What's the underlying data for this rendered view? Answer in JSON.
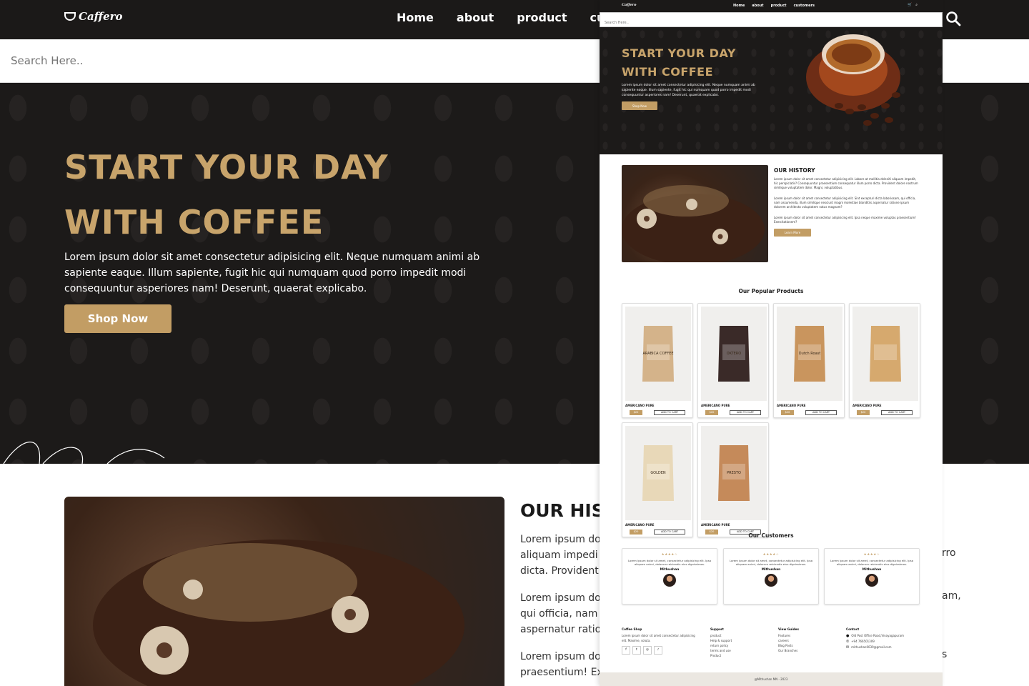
{
  "brand": {
    "logo": "Caffero"
  },
  "nav": {
    "links": [
      "Home",
      "about",
      "product",
      "customers"
    ]
  },
  "search": {
    "placeholder": "Search Here.."
  },
  "mobile_search": {
    "placeholder": "Search Here.."
  },
  "hero": {
    "line1": "START YOUR DAY",
    "line2": "WITH COFFEE",
    "text": "Lorem ipsum dolor sit amet consectetur adipisicing elit. Neque numquam animi ab sapiente eaque. Illum sapiente, fugit hic qui numquam quod porro impedit modi consequuntur asperiores nam! Deserunt, quaerat explicabo.",
    "cta": "Shop Now"
  },
  "history": {
    "title": "OUR HISTORY",
    "p1": "Lorem ipsum dolor sit amet consectetur adipisicing elit. Labore at mollitia deleniti aliquam impedit, hic perspiciatis? Consequuntur praesentium consequatur illum porro dicta. Provident dolore nostrum similique voluptatem dolor. Magni, voluptatibus.",
    "p2": "Lorem ipsum dolor sit amet consectetur adipisicing elit. Sint excepturi dicta laboriosam, qui officia, nam assumenda, illum similique nesciunt magni molestiae blanditiis aspernatur ratione ipsum dolorem architecto voluptatem natus magnam?",
    "p3": "Lorem ipsum dolor sit amet consectetur adipisicing elit. Ipsa neque maxime voluptas praesentium! Exercitationem?",
    "cta": "Learn More"
  },
  "bg_partial": {
    "title": "OUR HIS",
    "lines": [
      "Lorem ipsum do",
      "aliquam impedi",
      "dicta. Provident",
      "Lorem ipsum do",
      "qui officia, nam",
      "aspernatur ratio",
      "Lorem ipsum do",
      "praesentium! Ex"
    ],
    "right_fragments": [
      "rro",
      "am,",
      "s"
    ]
  },
  "products": {
    "title": "Our Popular Products",
    "items": [
      {
        "name": "AMERICANO PURE",
        "price": "$20",
        "cart": "ADD TO CART",
        "bag_label": "ARABICA COFFEE",
        "bag_color": "#d4b38a"
      },
      {
        "name": "AMERICANO PURE",
        "price": "$20",
        "cart": "ADD TO CART",
        "bag_label": "OKTERO",
        "bag_color": "#3a2a28"
      },
      {
        "name": "AMERICANO PURE",
        "price": "$20",
        "cart": "ADD TO CART",
        "bag_label": "Dutch Roast",
        "bag_color": "#c9955e"
      },
      {
        "name": "AMERICANO PURE",
        "price": "$20",
        "cart": "ADD TO CART",
        "bag_label": "",
        "bag_color": "#d6a96e"
      },
      {
        "name": "AMERICANO PURE",
        "price": "$20",
        "cart": "ADD TO CART",
        "bag_label": "GOLDEN",
        "bag_color": "#e8d8b8"
      },
      {
        "name": "AMERICANO PURE",
        "price": "$20",
        "cart": "ADD TO CART",
        "bag_label": "PRESTO",
        "bag_color": "#c58a5a"
      }
    ]
  },
  "customers": {
    "title": "Our Customers",
    "items": [
      {
        "stars": "★★★★☆",
        "text": "Lorem ipsum dolor sit amet, consectetur adipisicing elit. Ipsa aliquam animi, dolorum reiciendis eius dignissimos.",
        "name": "Mithushan"
      },
      {
        "stars": "★★★★☆",
        "text": "Lorem ipsum dolor sit amet, consectetur adipisicing elit. Ipsa aliquam animi, dolorum reiciendis eius dignissimos.",
        "name": "Mithushan"
      },
      {
        "stars": "★★★★☆",
        "text": "Lorem ipsum dolor sit amet, consectetur adipisicing elit. Ipsa aliquam animi, dolorum reiciendis eius dignissimos.",
        "name": "Mithushan"
      }
    ]
  },
  "footer": {
    "shop_title": "Coffee Shop",
    "shop_text": "Lorem ipsum dolor sit amet consectetur adipisicing elit. Maxime, soluta.",
    "support_title": "Support",
    "support_items": [
      "product",
      "Help & support",
      "return policy",
      "terms and use",
      "Product"
    ],
    "guides_title": "View Guides",
    "guides_items": [
      "Features",
      "careers",
      "Blog Posts",
      "Our Branches"
    ],
    "contact_title": "Contact",
    "address": "Old Post Office Road,Vinayagapuram",
    "phone": "+94 766501309",
    "email": "mithushan0039@gmail.com",
    "copyright": "@Mithushan MN - 2023"
  },
  "colors": {
    "accent": "#c29d64",
    "dark": "#1c1a19",
    "footer_bottom": "#ebe7e1"
  }
}
